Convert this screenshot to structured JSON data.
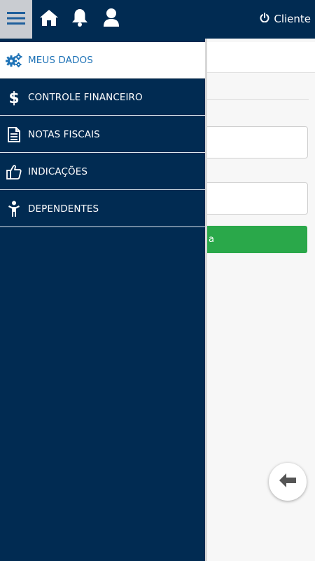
{
  "header": {
    "user_label": "Cliente",
    "icons": [
      "hamburger-menu-icon",
      "home-icon",
      "bell-icon",
      "user-icon",
      "power-icon"
    ]
  },
  "page": {
    "button_fragment": "a"
  },
  "drawer": {
    "items": [
      {
        "label": "MEUS DADOS",
        "icon": "gears-icon",
        "active": true
      },
      {
        "label": "CONTROLE FINANCEIRO",
        "icon": "dollar-icon",
        "active": false
      },
      {
        "label": "NOTAS FISCAIS",
        "icon": "document-icon",
        "active": false
      },
      {
        "label": "INDICAÇÕES",
        "icon": "thumbs-up-icon",
        "active": false
      },
      {
        "label": "DEPENDENTES",
        "icon": "person-icon",
        "active": false
      }
    ]
  },
  "colors": {
    "navy": "#012b52",
    "active_text": "#1f73b7",
    "green": "#2aa84a"
  }
}
